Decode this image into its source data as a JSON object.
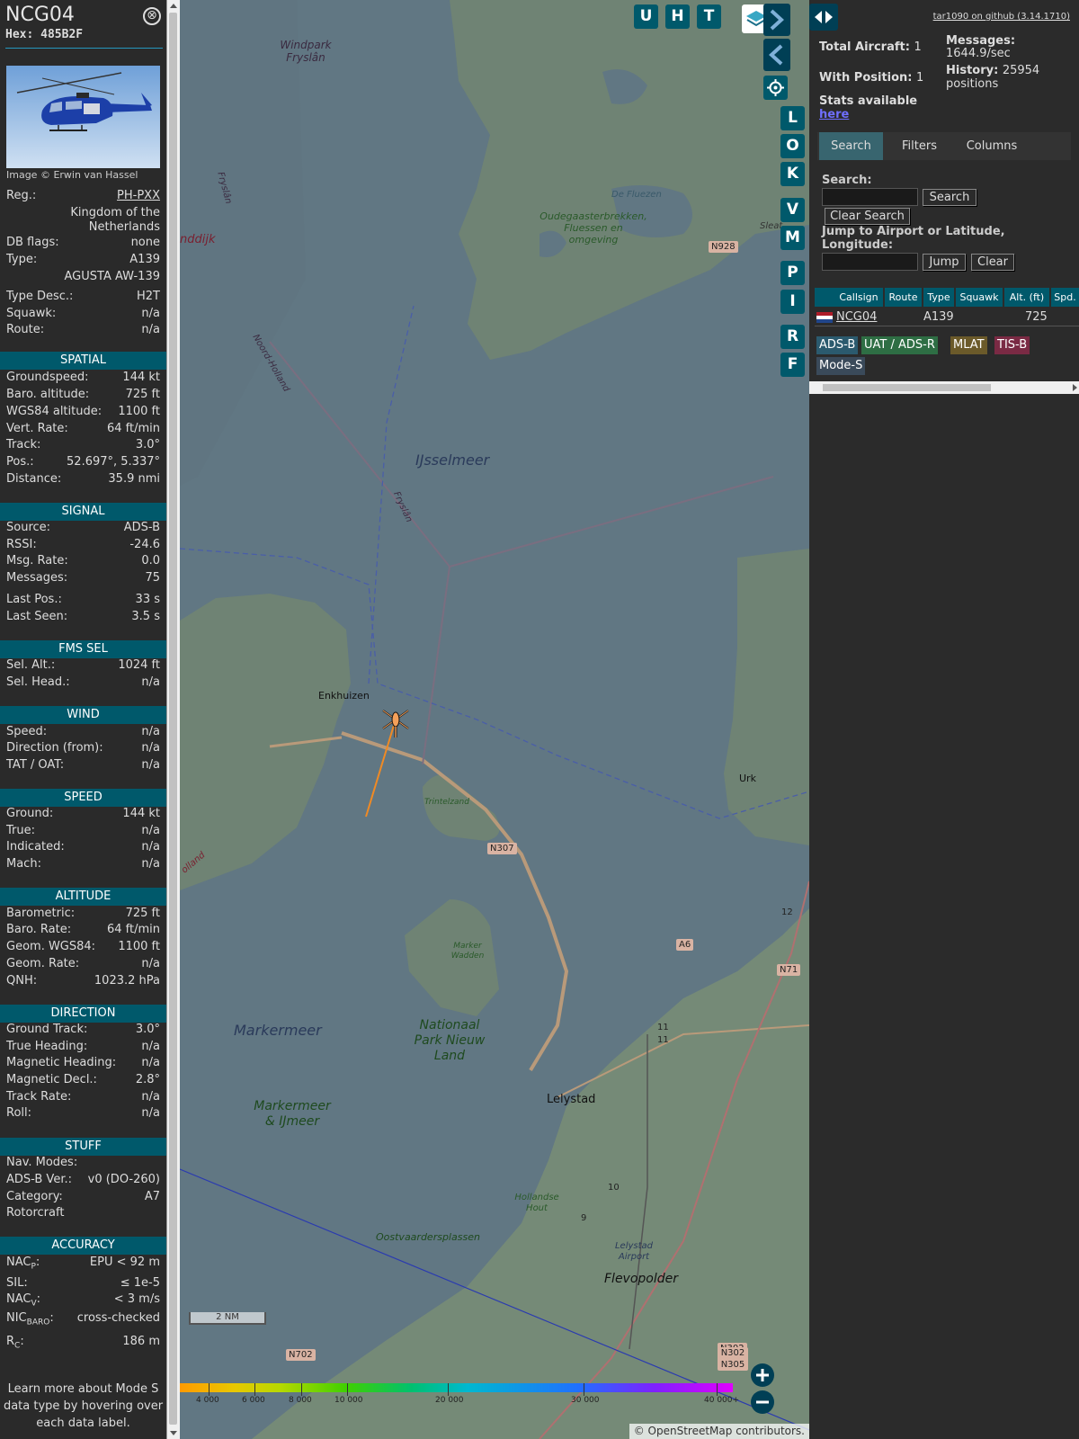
{
  "aircraft": {
    "callsign": "NCG04",
    "hex": "Hex: 485B2F",
    "close_icon": "⊗",
    "image_credit": "Image © Erwin van Hassel",
    "fields": [
      {
        "k": "Reg.:",
        "v": "PH-PXX"
      },
      {
        "k": "",
        "v": "Kingdom of the Netherlands"
      },
      {
        "k": "DB flags:",
        "v": "none"
      },
      {
        "k": "Type:",
        "v": "A139"
      },
      {
        "k": "",
        "v": "AGUSTA AW-139"
      },
      {
        "k": "Type Desc.:",
        "v": "H2T"
      },
      {
        "k": "Squawk:",
        "v": "n/a"
      },
      {
        "k": "Route:",
        "v": "n/a"
      }
    ]
  },
  "sections": {
    "spatial": {
      "title": "SPATIAL",
      "rows": [
        {
          "k": "Groundspeed:",
          "v": "144 kt"
        },
        {
          "k": "Baro. altitude:",
          "v": "725 ft"
        },
        {
          "k": "WGS84 altitude:",
          "v": "1100 ft"
        },
        {
          "k": "Vert. Rate:",
          "v": "64 ft/min"
        },
        {
          "k": "Track:",
          "v": "3.0°"
        },
        {
          "k": "Pos.:",
          "v": "52.697°, 5.337°"
        },
        {
          "k": "Distance:",
          "v": "35.9 nmi"
        }
      ]
    },
    "signal": {
      "title": "SIGNAL",
      "rows": [
        {
          "k": "Source:",
          "v": "ADS-B"
        },
        {
          "k": "RSSI:",
          "v": "-24.6"
        },
        {
          "k": "Msg. Rate:",
          "v": "0.0"
        },
        {
          "k": "Messages:",
          "v": "75"
        },
        {
          "k": "Last Pos.:",
          "v": "33 s"
        },
        {
          "k": "Last Seen:",
          "v": "3.5 s"
        }
      ]
    },
    "fms": {
      "title": "FMS SEL",
      "rows": [
        {
          "k": "Sel. Alt.:",
          "v": "1024 ft"
        },
        {
          "k": "Sel. Head.:",
          "v": "n/a"
        }
      ]
    },
    "wind": {
      "title": "WIND",
      "rows": [
        {
          "k": "Speed:",
          "v": "n/a"
        },
        {
          "k": "Direction (from):",
          "v": "n/a"
        },
        {
          "k": "TAT / OAT:",
          "v": "n/a"
        }
      ]
    },
    "speed": {
      "title": "SPEED",
      "rows": [
        {
          "k": "Ground:",
          "v": "144 kt"
        },
        {
          "k": "True:",
          "v": "n/a"
        },
        {
          "k": "Indicated:",
          "v": "n/a"
        },
        {
          "k": "Mach:",
          "v": "n/a"
        }
      ]
    },
    "altitude": {
      "title": "ALTITUDE",
      "rows": [
        {
          "k": "Barometric:",
          "v": "725 ft"
        },
        {
          "k": "Baro. Rate:",
          "v": "64 ft/min"
        },
        {
          "k": "Geom. WGS84:",
          "v": "1100 ft"
        },
        {
          "k": "Geom. Rate:",
          "v": "n/a"
        },
        {
          "k": "QNH:",
          "v": "1023.2 hPa"
        }
      ]
    },
    "direction": {
      "title": "DIRECTION",
      "rows": [
        {
          "k": "Ground Track:",
          "v": "3.0°"
        },
        {
          "k": "True Heading:",
          "v": "n/a"
        },
        {
          "k": "Magnetic Heading:",
          "v": "n/a"
        },
        {
          "k": "Magnetic Decl.:",
          "v": "2.8°"
        },
        {
          "k": "Track Rate:",
          "v": "n/a"
        },
        {
          "k": "Roll:",
          "v": "n/a"
        }
      ]
    },
    "stuff": {
      "title": "STUFF",
      "rows": [
        {
          "k": "Nav. Modes:",
          "v": ""
        },
        {
          "k": "ADS-B Ver.:",
          "v": "v0 (DO-260)"
        },
        {
          "k": "Category:",
          "v": "A7"
        },
        {
          "k": "Rotorcraft",
          "v": ""
        }
      ]
    },
    "accuracy": {
      "title": "ACCURACY",
      "rows": [
        {
          "k": "NAC",
          "sub": "P",
          "v": "EPU < 92 m"
        },
        {
          "k": "SIL:",
          "v": "≤ 1e-5"
        },
        {
          "k": "NAC",
          "sub": "V",
          "v": "< 3 m/s"
        },
        {
          "k": "NIC",
          "sub": "BARO",
          "v": "cross-checked"
        },
        {
          "k": "R",
          "sub": "C",
          "v": "186 m"
        }
      ]
    }
  },
  "learn_more": "Learn more about Mode S data type by hovering over each data label.",
  "map": {
    "top_buttons": [
      "U",
      "H",
      "T"
    ],
    "side_buttons": [
      "L",
      "O",
      "K",
      "V",
      "M",
      "P",
      "I",
      "R",
      "F"
    ],
    "labels": {
      "windpark": "Windpark Fryslân",
      "friesland": "Fryslân",
      "andijk": "nddijk",
      "noord_holland": "Noord-Holland",
      "oudega": "Oudegaasterbrekken, Fluessen en omgeving",
      "de_fluezen": "De Fluezen",
      "sleat": "Sleat",
      "ijsselmeer": "IJsselmeer",
      "fryslan_line": "Fryslân",
      "enkhuizen": "Enkhuizen",
      "urk": "Urk",
      "trintelzand": "Trintelzand",
      "marker_wadden": "Marker Wadden",
      "markermeer": "Markermeer",
      "npnl": "Nationaal Park Nieuw Land",
      "markermeer_ijmeer": "Markermeer & IJmeer",
      "lelystad": "Lelystad",
      "hollandse_hout": "Hollandse Hout",
      "oostvaardersplassen": "Oostvaardersplassen",
      "lelystad_airport": "Lelystad Airport",
      "flevopolder": "Flevopolder",
      "holland": "olland"
    },
    "road_labels": [
      "N928",
      "N307",
      "A6",
      "N71",
      "N302",
      "N702",
      "N302 N305",
      "12",
      "11",
      "11",
      "10",
      "9"
    ],
    "altitude_scale": [
      "4 000",
      "6 000",
      "8 000",
      "10 000",
      "20 000",
      "30 000",
      "40 000+"
    ],
    "scale_label": "2 NM",
    "attribution_prefix": "© ",
    "attribution_link": "OpenStreetMap",
    "attribution_suffix": " contributors."
  },
  "right": {
    "version": "tar1090 on github (3.14.1710)",
    "total_label": "Total Aircraft:",
    "total_value": "1",
    "withpos_label": "With Position:",
    "withpos_value": "1",
    "stats_label": "Stats available",
    "stats_link": "here",
    "messages_label": "Messages:",
    "messages_value": "1644.9/sec",
    "history_label": "History:",
    "history_value": "25954 positions",
    "tabs": [
      "Search",
      "Filters",
      "Columns"
    ],
    "search_label": "Search:",
    "search_btn": "Search",
    "clear_search_btn": "Clear Search",
    "jump_label": "Jump to Airport or Latitude, Longitude:",
    "jump_btn": "Jump",
    "clear_btn": "Clear",
    "columns": [
      "Callsign",
      "Route",
      "Type",
      "Squawk",
      "Alt. (ft)",
      "Spd."
    ],
    "row": {
      "callsign": "NCG04",
      "route": "",
      "type": "A139",
      "squawk": "",
      "alt": "725"
    },
    "badges": [
      {
        "label": "ADS-B",
        "color": "#2b5a6e"
      },
      {
        "label": "UAT / ADS-R",
        "color": "#2e6e44"
      },
      {
        "label": "MLAT",
        "color": "#6b5a2a"
      },
      {
        "label": "TIS-B",
        "color": "#7a2a44"
      },
      {
        "label": "Mode-S",
        "color": "#3a4a5a"
      }
    ]
  }
}
